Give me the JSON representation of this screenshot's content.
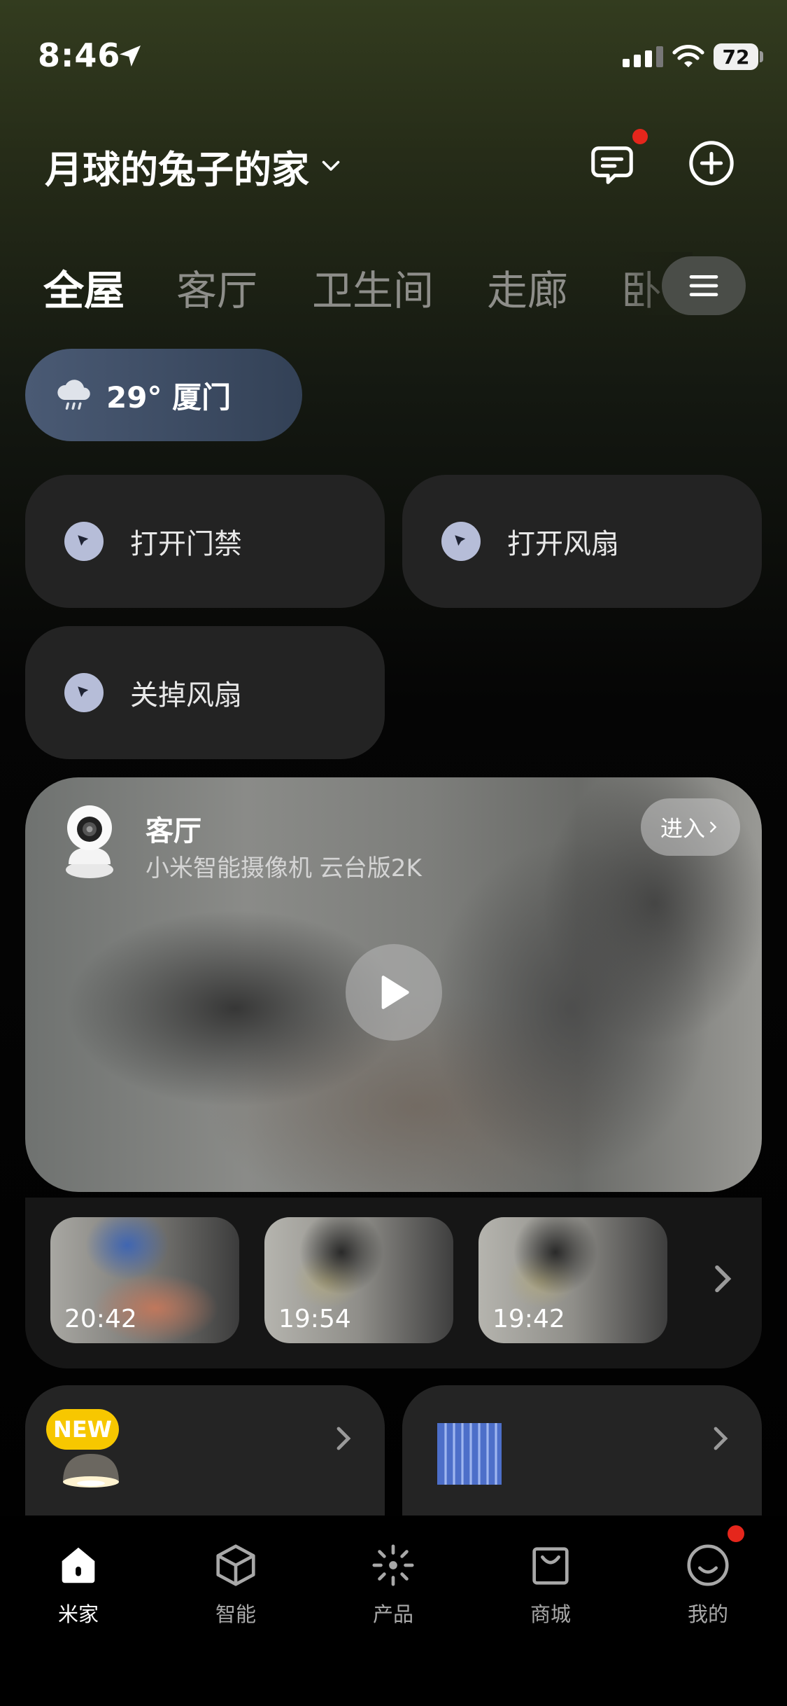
{
  "status_bar": {
    "time": "8:46",
    "battery": "72"
  },
  "header": {
    "home_name": "月球的兔子的家"
  },
  "tabs": [
    "全屋",
    "客厅",
    "卫生间",
    "走廊",
    "卧室"
  ],
  "weather": {
    "text": "29° 厦门"
  },
  "scenes": [
    {
      "label": "打开门禁"
    },
    {
      "label": "打开风扇"
    },
    {
      "label": "关掉风扇"
    }
  ],
  "camera": {
    "room": "客厅",
    "model": "小米智能摄像机 云台版2K",
    "enter_label": "进入"
  },
  "clips": [
    {
      "time": "20:42"
    },
    {
      "time": "19:54"
    },
    {
      "time": "19:42"
    }
  ],
  "devices": {
    "new_badge": "NEW"
  },
  "bottom_nav": [
    {
      "label": "米家",
      "icon": "home-icon",
      "active": true
    },
    {
      "label": "智能",
      "icon": "cube-icon"
    },
    {
      "label": "产品",
      "icon": "sparkle-icon"
    },
    {
      "label": "商城",
      "icon": "shopping-bag-icon"
    },
    {
      "label": "我的",
      "icon": "smiley-icon"
    }
  ],
  "colors": {
    "accent_red": "#e5261c",
    "new_badge": "#f7c700",
    "weather_pill": "#3d4b63",
    "card_bg": "#232323"
  }
}
